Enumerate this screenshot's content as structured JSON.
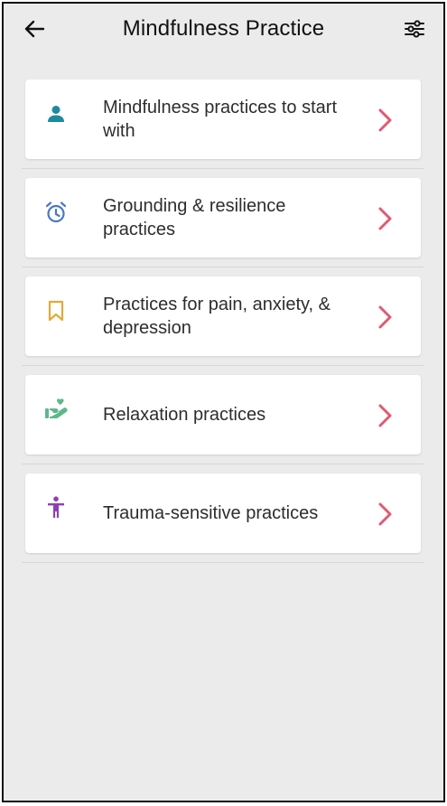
{
  "header": {
    "title": "Mindfulness Practice",
    "back_icon": "arrow-left-icon",
    "filter_icon": "sliders-icon"
  },
  "items": [
    {
      "label": "Mindfulness practices to start with",
      "icon": "person-icon",
      "icon_color": "#1f8a9e"
    },
    {
      "label": "Grounding & resilience practices",
      "icon": "alarm-clock-icon",
      "icon_color": "#4a78c2"
    },
    {
      "label": "Practices for pain, anxiety, & depression",
      "icon": "bookmark-icon",
      "icon_color": "#e3a93a"
    },
    {
      "label": "Relaxation practices",
      "icon": "hand-heart-icon",
      "icon_color": "#5fb88a"
    },
    {
      "label": "Trauma-sensitive practices",
      "icon": "accessibility-figure-icon",
      "icon_color": "#8e3fb3"
    }
  ],
  "colors": {
    "background": "#ebebeb",
    "card": "#ffffff",
    "chevron": "#e05a72",
    "text": "#2d2d2d"
  }
}
